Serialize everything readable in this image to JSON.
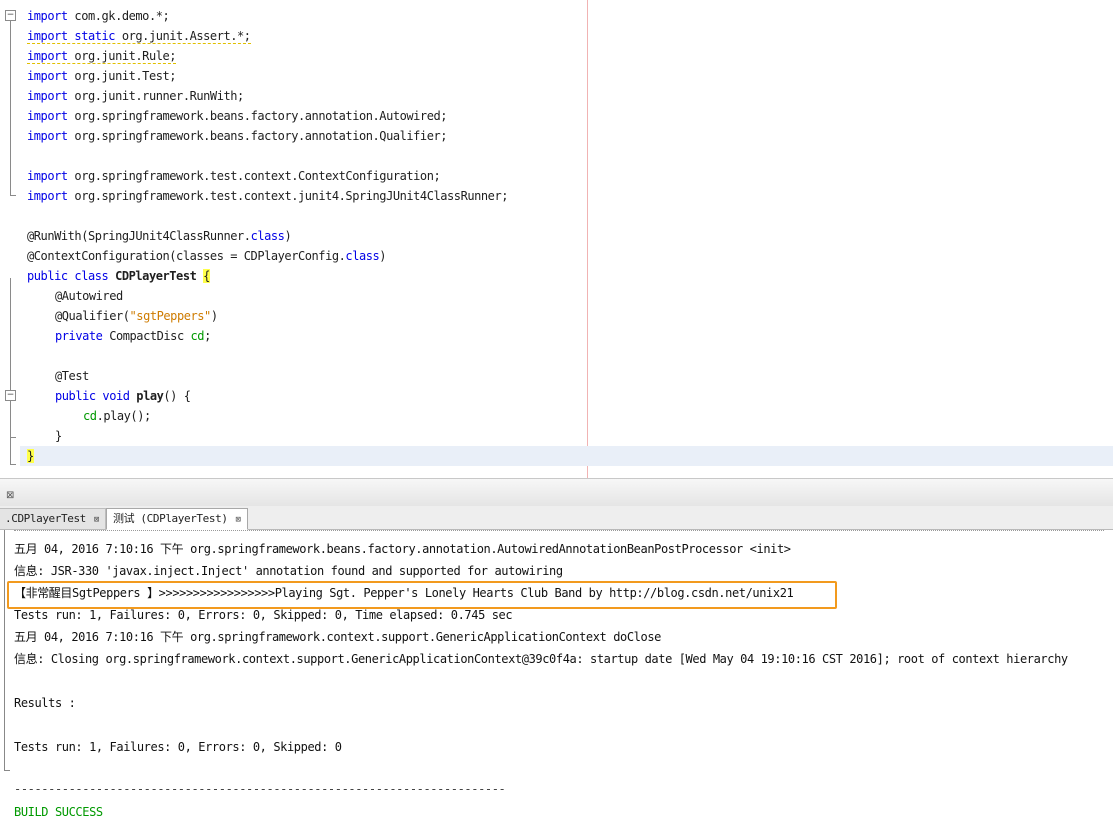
{
  "editor": {
    "code": {
      "l1_kw": "import",
      "l1_rest": " com.gk.demo.*;",
      "l2_kw": "import static",
      "l2_rest": " org.junit.Assert.*;",
      "l3_kw": "import",
      "l3_rest": " org.junit.Rule;",
      "l4_kw": "import",
      "l4_rest": " org.junit.Test;",
      "l5_kw": "import",
      "l5_rest": " org.junit.runner.RunWith;",
      "l6_kw": "import",
      "l6_rest": " org.springframework.beans.factory.annotation.Autowired;",
      "l7_kw": "import",
      "l7_rest": " org.springframework.beans.factory.annotation.Qualifier;",
      "l9_kw": "import",
      "l9_rest": " org.springframework.test.context.ContextConfiguration;",
      "l10_kw": "import",
      "l10_rest": " org.springframework.test.context.junit4.SpringJUnit4ClassRunner;",
      "l12_a": "@RunWith(SpringJUnit4ClassRunner.",
      "l12_kw": "class",
      "l12_b": ")",
      "l13_a": "@ContextConfiguration(classes = CDPlayerConfig.",
      "l13_kw": "class",
      "l13_b": ")",
      "l14_kw": "public class",
      "l14_name": " CDPlayerTest",
      "l14_brace": "{",
      "l15": "@Autowired",
      "l16_a": "@Qualifier(",
      "l16_str": "\"sgtPeppers\"",
      "l16_b": ")",
      "l17_kw": "private",
      "l17_type": " CompactDisc ",
      "l17_field": "cd",
      "l17_end": ";",
      "l19": "@Test",
      "l20_kw": "public void",
      "l20_name": " play",
      "l20_rest": "() {",
      "l21_field": "cd",
      "l21_rest": ".play();",
      "l22": "}",
      "l23": "}"
    }
  },
  "tabs": {
    "tab1_label": ".CDPlayerTest",
    "tab2_label": "测试 (CDPlayerTest)",
    "close_glyph": "⊠"
  },
  "console": {
    "lines": {
      "o1": "五月 04, 2016 7:10:16 下午 org.springframework.beans.factory.annotation.AutowiredAnnotationBeanPostProcessor <init>",
      "o2": "信息: JSR-330 'javax.inject.Inject' annotation found and supported for autowiring",
      "o3": "【非常醒目SgtPeppers 】>>>>>>>>>>>>>>>>>Playing Sgt. Pepper's Lonely Hearts Club Band by http://blog.csdn.net/unix21",
      "o4": "Tests run: 1, Failures: 0, Errors: 0, Skipped: 0, Time elapsed: 0.745 sec",
      "o5": "五月 04, 2016 7:10:16 下午 org.springframework.context.support.GenericApplicationContext doClose",
      "o6": "信息: Closing org.springframework.context.support.GenericApplicationContext@39c0f4a: startup date [Wed May 04 19:10:16 CST 2016]; root of context hierarchy",
      "o8": "Results :",
      "o10": "Tests run: 1, Failures: 0, Errors: 0, Skipped: 0",
      "o12": "------------------------------------------------------------------------",
      "o13": "BUILD SUCCESS"
    },
    "highlight_color": "#f29a1e",
    "success_color": "#009900"
  }
}
